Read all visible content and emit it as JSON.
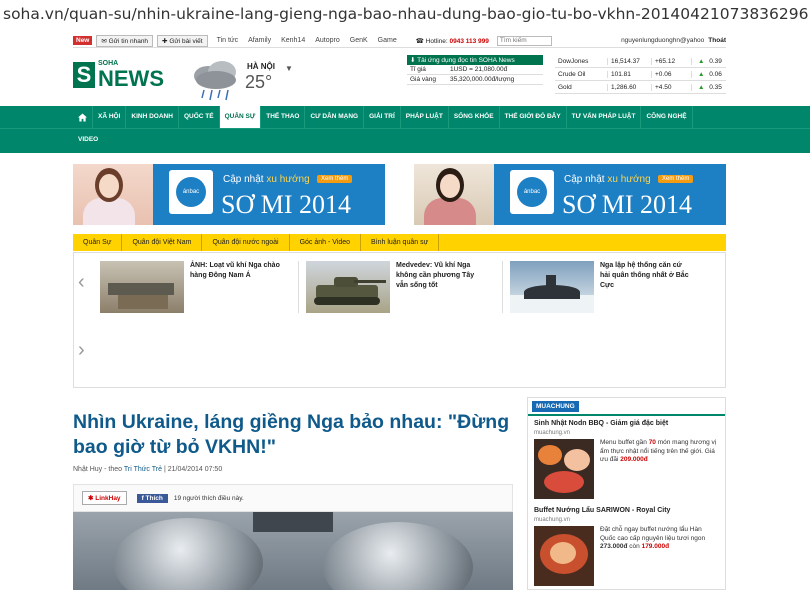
{
  "browser": {
    "url": "soha.vn/quan-su/nhin-ukraine-lang-gieng-nga-bao-nhau-dung-bao-gio-tu-bo-vkhn-20140421073836296.htm"
  },
  "topbar": {
    "new_badge": "New",
    "quick_send": "Gửi tin nhanh",
    "post_article": "Gửi bài viết",
    "links": [
      "Tin tức",
      "Afamily",
      "Kenh14",
      "Autopro",
      "GenK",
      "Game"
    ],
    "hotline_label": "Hotline:",
    "hotline_number": "0943 113 999",
    "search_placeholder": "Tìm kiếm",
    "user": "nguyenlungduonghn@yahoo",
    "logout": "Thoát"
  },
  "logo": {
    "s": "S",
    "soha": "SOHA",
    "news": "NEWS"
  },
  "weather": {
    "city": "HÀ NỘI",
    "temp": "25°"
  },
  "market": {
    "header": "Tải ứng dụng đọc tin SOHA News",
    "rows": [
      {
        "label": "Tỉ giá",
        "value": "1USD = 21,080.00đ"
      },
      {
        "label": "Giá vàng",
        "value": "35,320,000.00đ/lượng"
      }
    ]
  },
  "stocks": [
    {
      "name": "DowJones",
      "value": "16,514.37",
      "change": "+65.12",
      "pct": "0.39"
    },
    {
      "name": "Crude Oil",
      "value": "101.81",
      "change": "+0.06",
      "pct": "0.06"
    },
    {
      "name": "Gold",
      "value": "1,286.60",
      "change": "+4.50",
      "pct": "0.35"
    }
  ],
  "nav": {
    "items": [
      "XÃ HỘI",
      "KINH DOANH",
      "QUỐC TẾ",
      "QUÂN SỰ",
      "THỂ THAO",
      "CƯ DÂN MẠNG",
      "GIẢI TRÍ",
      "PHÁP LUẬT",
      "SỐNG KHỎE",
      "THẾ GIỚI ĐÓ ĐÂY",
      "TƯ VẤN PHÁP LUẬT",
      "CÔNG NGHỆ"
    ],
    "video": "VIDEO"
  },
  "banners": [
    {
      "cap": "Cập nhật",
      "trend": "xu hướng",
      "btn": "Xem thêm",
      "big": "SƠ MI 2014",
      "brand": "ánbac"
    },
    {
      "cap": "Cập nhật",
      "trend": "xu hướng",
      "btn": "Xem thêm",
      "big": "SƠ MI 2014",
      "brand": "ánbac"
    }
  ],
  "subnav": [
    "Quân Sự",
    "Quân đội Việt Nam",
    "Quân đội nước ngoài",
    "Góc ảnh - Video",
    "Bình luận quân sự"
  ],
  "slider": [
    {
      "text": "ẢNH: Loạt vũ khí Nga chào hàng Đông Nam Á"
    },
    {
      "text": "Medvedev: Vũ khí Nga không cần phương Tây vẫn sống tốt"
    },
    {
      "text": "Nga lập hệ thống căn cứ hải quân thống nhất ở Bắc Cực"
    }
  ],
  "article": {
    "title": "Nhìn Ukraine, láng giềng Nga bảo nhau: \"Đừng bao giờ từ bỏ VKHN!\"",
    "author": "Nhật Huy - theo",
    "source": "Tri Thức Trẻ",
    "date": "| 21/04/2014 07:50",
    "linkhay": "LinkHay",
    "fb_like": "Thích",
    "likes": "19 người thích điều này."
  },
  "sidebar": {
    "brand": "MUACHUNG",
    "deals": [
      {
        "title": "Sinh Nhật Nodn BBQ - Giảm giá đặc biệt",
        "src": "muachung.vn",
        "text_a": "Menu buffet gần",
        "num": "70",
        "text_b": "món mang hương vị ẩm thực nhật nổi tiếng trên thế giới. Giá ưu đãi",
        "price": "209.000đ"
      },
      {
        "title": "Buffet Nướng Lẩu SARIWON - Royal City",
        "src": "muachung.vn",
        "text_a": "Đặt chỗ ngay buffet nướng lẩu Hàn Quốc cao cấp nguyên liệu tươi ngon",
        "price_old": "273.000đ",
        "text_c": "còn",
        "price": "179.000đ"
      }
    ]
  }
}
